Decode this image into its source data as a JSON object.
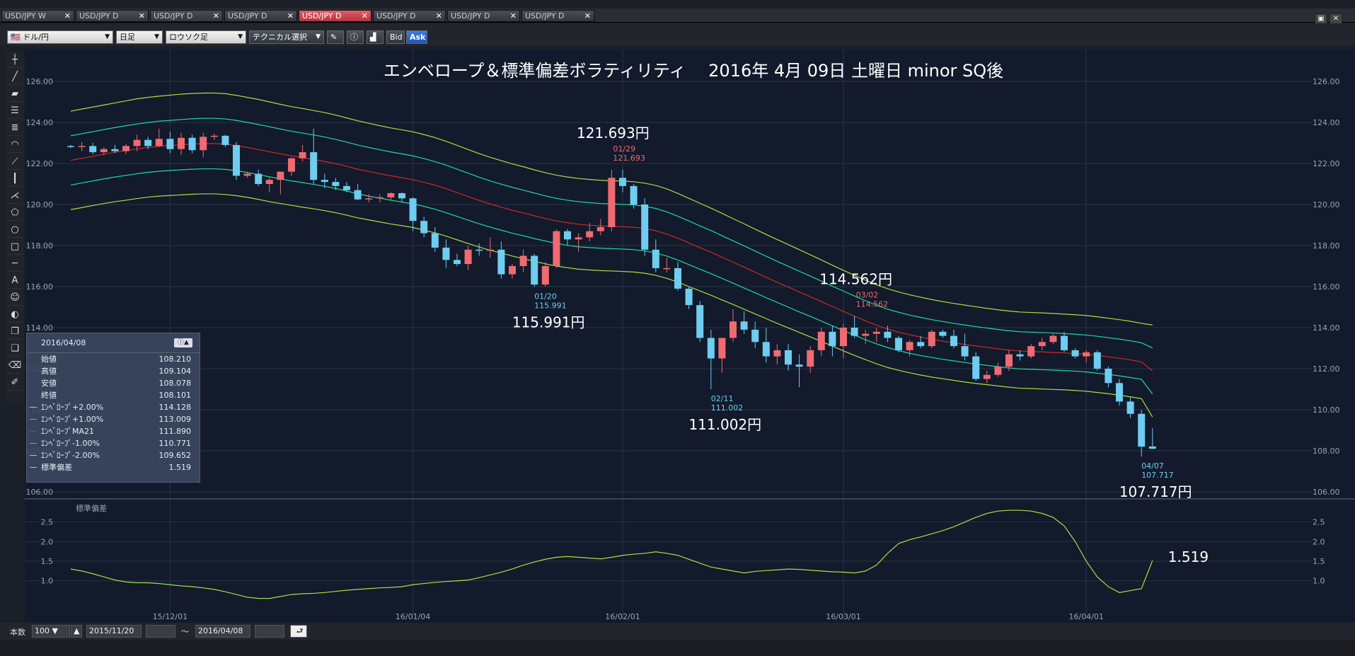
{
  "tabs": [
    {
      "label": "USD/JPY W",
      "active": false
    },
    {
      "label": "USD/JPY D",
      "active": false
    },
    {
      "label": "USD/JPY D",
      "active": false
    },
    {
      "label": "USD/JPY D",
      "active": false
    },
    {
      "label": "USD/JPY D",
      "active": true
    },
    {
      "label": "USD/JPY D",
      "active": false
    },
    {
      "label": "USD/JPY D",
      "active": false
    },
    {
      "label": "USD/JPY D",
      "active": false
    }
  ],
  "toolbar": {
    "pair": "ドル/円",
    "period": "日足",
    "chart_type": "ロウソク足",
    "technical": "テクニカル選択",
    "bid": "Bid",
    "ask": "Ask"
  },
  "chart": {
    "title": "エンベロープ＆標準偏差ボラティリティ　 2016年 4月 09日 土曜日  minor SQ後",
    "ylim": [
      106,
      126
    ],
    "yticks": [
      "126.00",
      "124.00",
      "122.00",
      "120.00",
      "118.00",
      "116.00",
      "114.00",
      "112.00",
      "110.00",
      "108.00",
      "106.00"
    ],
    "xticks": [
      {
        "label": "15/12/01",
        "i": 9
      },
      {
        "label": "16/01/04",
        "i": 31
      },
      {
        "label": "16/02/01",
        "i": 50
      },
      {
        "label": "16/03/01",
        "i": 70
      },
      {
        "label": "16/04/01",
        "i": 92
      }
    ],
    "candles": [
      [
        122.85,
        122.9,
        122.75,
        122.8
      ],
      [
        122.8,
        123.05,
        122.6,
        122.85
      ],
      [
        122.85,
        123.0,
        122.45,
        122.55
      ],
      [
        122.55,
        122.8,
        122.4,
        122.7
      ],
      [
        122.7,
        122.9,
        122.5,
        122.6
      ],
      [
        122.6,
        122.95,
        122.45,
        122.85
      ],
      [
        122.85,
        123.4,
        122.6,
        123.15
      ],
      [
        123.15,
        123.3,
        122.7,
        122.85
      ],
      [
        122.85,
        123.7,
        122.8,
        123.2
      ],
      [
        123.2,
        123.55,
        122.5,
        122.7
      ],
      [
        122.7,
        123.5,
        122.4,
        123.25
      ],
      [
        123.25,
        123.4,
        122.5,
        122.65
      ],
      [
        122.65,
        123.5,
        122.3,
        123.3
      ],
      [
        123.3,
        123.45,
        123.15,
        123.35
      ],
      [
        123.35,
        123.4,
        122.8,
        122.9
      ],
      [
        122.9,
        123.05,
        121.2,
        121.4
      ],
      [
        121.4,
        121.6,
        121.3,
        121.5
      ],
      [
        121.5,
        121.7,
        120.9,
        121.0
      ],
      [
        121.0,
        121.3,
        120.6,
        121.2
      ],
      [
        121.2,
        121.6,
        120.5,
        121.6
      ],
      [
        121.6,
        122.3,
        121.4,
        122.25
      ],
      [
        122.25,
        122.9,
        122.1,
        122.55
      ],
      [
        122.55,
        123.7,
        121.0,
        121.2
      ],
      [
        121.2,
        121.5,
        120.8,
        121.1
      ],
      [
        121.1,
        121.3,
        120.7,
        120.9
      ],
      [
        120.9,
        121.1,
        120.6,
        120.7
      ],
      [
        120.7,
        121.0,
        120.2,
        120.25
      ],
      [
        120.25,
        120.5,
        120.1,
        120.3
      ],
      [
        120.3,
        120.5,
        120.1,
        120.35
      ],
      [
        120.35,
        120.6,
        120.2,
        120.55
      ],
      [
        120.55,
        120.6,
        120.1,
        120.3
      ],
      [
        120.3,
        120.35,
        118.7,
        119.2
      ],
      [
        119.2,
        119.4,
        118.4,
        118.6
      ],
      [
        118.6,
        118.9,
        117.7,
        117.9
      ],
      [
        117.9,
        118.3,
        116.9,
        117.3
      ],
      [
        117.3,
        117.6,
        117.0,
        117.1
      ],
      [
        117.1,
        118.0,
        116.8,
        117.8
      ],
      [
        117.8,
        118.1,
        117.5,
        117.75
      ],
      [
        117.75,
        118.4,
        117.4,
        117.8
      ],
      [
        117.8,
        118.2,
        116.4,
        116.6
      ],
      [
        116.6,
        117.1,
        116.4,
        117.0
      ],
      [
        117.0,
        117.8,
        116.7,
        117.5
      ],
      [
        117.5,
        117.6,
        115.991,
        116.1
      ],
      [
        116.1,
        117.2,
        116.0,
        117.0
      ],
      [
        117.0,
        118.8,
        116.9,
        118.7
      ],
      [
        118.7,
        118.8,
        118.0,
        118.3
      ],
      [
        118.3,
        118.6,
        117.7,
        118.4
      ],
      [
        118.4,
        119.1,
        118.2,
        118.7
      ],
      [
        118.7,
        119.3,
        118.5,
        118.9
      ],
      [
        118.9,
        121.693,
        118.7,
        121.3
      ],
      [
        121.3,
        121.7,
        120.6,
        120.9
      ],
      [
        120.9,
        121.0,
        119.8,
        120.0
      ],
      [
        120.0,
        120.3,
        117.5,
        117.8
      ],
      [
        117.8,
        118.3,
        116.7,
        116.9
      ],
      [
        116.9,
        117.4,
        116.7,
        116.9
      ],
      [
        116.9,
        117.2,
        115.8,
        115.9
      ],
      [
        115.9,
        116.0,
        114.9,
        115.1
      ],
      [
        115.1,
        115.3,
        113.3,
        113.5
      ],
      [
        113.5,
        113.9,
        111.002,
        112.5
      ],
      [
        112.5,
        113.2,
        111.8,
        113.5
      ],
      [
        113.5,
        114.9,
        113.3,
        114.3
      ],
      [
        114.3,
        114.8,
        113.7,
        113.9
      ],
      [
        113.9,
        114.3,
        113.0,
        113.3
      ],
      [
        113.3,
        114.0,
        112.3,
        112.6
      ],
      [
        112.6,
        113.2,
        112.2,
        112.9
      ],
      [
        112.9,
        113.2,
        111.9,
        112.2
      ],
      [
        112.2,
        112.7,
        111.1,
        112.1
      ],
      [
        112.1,
        113.1,
        111.8,
        112.9
      ],
      [
        112.9,
        114.0,
        112.6,
        113.8
      ],
      [
        113.8,
        114.1,
        112.6,
        113.1
      ],
      [
        113.1,
        114.2,
        112.5,
        114.0
      ],
      [
        114.0,
        114.562,
        113.5,
        113.6
      ],
      [
        113.6,
        113.9,
        113.2,
        113.7
      ],
      [
        113.7,
        114.0,
        113.3,
        113.8
      ],
      [
        113.8,
        114.1,
        113.3,
        113.5
      ],
      [
        113.5,
        113.6,
        112.8,
        112.9
      ],
      [
        112.9,
        113.4,
        112.6,
        113.3
      ],
      [
        113.3,
        113.6,
        113.0,
        113.1
      ],
      [
        113.1,
        113.9,
        113.0,
        113.8
      ],
      [
        113.8,
        113.9,
        113.5,
        113.6
      ],
      [
        113.6,
        113.9,
        113.0,
        113.1
      ],
      [
        113.1,
        113.7,
        112.4,
        112.6
      ],
      [
        112.6,
        112.8,
        111.4,
        111.5
      ],
      [
        111.5,
        111.9,
        111.3,
        111.7
      ],
      [
        111.7,
        112.3,
        111.6,
        112.1
      ],
      [
        112.1,
        112.9,
        111.9,
        112.7
      ],
      [
        112.7,
        112.9,
        112.4,
        112.6
      ],
      [
        112.6,
        113.2,
        112.5,
        113.1
      ],
      [
        113.1,
        113.5,
        112.9,
        113.3
      ],
      [
        113.3,
        113.7,
        113.2,
        113.6
      ],
      [
        113.6,
        113.8,
        112.8,
        112.9
      ],
      [
        112.9,
        113.0,
        112.5,
        112.6
      ],
      [
        112.6,
        112.9,
        112.3,
        112.8
      ],
      [
        112.8,
        112.9,
        111.9,
        112.0
      ],
      [
        112.0,
        112.1,
        111.1,
        111.3
      ],
      [
        111.3,
        111.5,
        110.2,
        110.4
      ],
      [
        110.4,
        110.6,
        109.6,
        109.8
      ],
      [
        109.8,
        110.0,
        107.717,
        108.2
      ],
      [
        108.21,
        109.104,
        108.078,
        108.101
      ]
    ],
    "env_upper2": [
      124.55,
      124.65,
      124.75,
      124.85,
      124.95,
      125.05,
      125.15,
      125.22,
      125.28,
      125.33,
      125.38,
      125.41,
      125.43,
      125.43,
      125.4,
      125.32,
      125.22,
      125.12,
      125.0,
      124.88,
      124.77,
      124.68,
      124.58,
      124.48,
      124.36,
      124.22,
      124.08,
      123.96,
      123.84,
      123.73,
      123.64,
      123.54,
      123.41,
      123.26,
      123.08,
      122.88,
      122.68,
      122.48,
      122.3,
      122.14,
      121.98,
      121.84,
      121.69,
      121.55,
      121.43,
      121.34,
      121.27,
      121.22,
      121.18,
      121.16,
      121.14,
      121.11,
      121.04,
      120.93,
      120.76,
      120.54,
      120.3,
      120.06,
      119.82,
      119.57,
      119.31,
      119.06,
      118.8,
      118.54,
      118.29,
      118.05,
      117.8,
      117.55,
      117.3,
      117.04,
      116.79,
      116.55,
      116.31,
      116.09,
      115.9,
      115.74,
      115.6,
      115.48,
      115.37,
      115.27,
      115.18,
      115.1,
      115.02,
      114.94,
      114.87,
      114.81,
      114.76,
      114.74,
      114.72,
      114.69,
      114.66,
      114.63,
      114.59,
      114.53,
      114.46,
      114.39,
      114.31,
      114.21,
      114.13
    ],
    "env_upper1": [
      123.35,
      123.45,
      123.55,
      123.65,
      123.75,
      123.84,
      123.92,
      124.0,
      124.06,
      124.1,
      124.14,
      124.18,
      124.2,
      124.2,
      124.17,
      124.1,
      124.0,
      123.9,
      123.79,
      123.68,
      123.57,
      123.48,
      123.39,
      123.29,
      123.17,
      123.04,
      122.9,
      122.78,
      122.67,
      122.56,
      122.47,
      122.37,
      122.24,
      122.09,
      121.92,
      121.72,
      121.53,
      121.33,
      121.15,
      120.99,
      120.84,
      120.7,
      120.56,
      120.42,
      120.3,
      120.21,
      120.14,
      120.09,
      120.05,
      120.03,
      120.01,
      119.98,
      119.91,
      119.81,
      119.64,
      119.43,
      119.2,
      118.96,
      118.73,
      118.48,
      118.23,
      117.99,
      117.73,
      117.48,
      117.23,
      116.99,
      116.75,
      116.51,
      116.27,
      116.02,
      115.78,
      115.54,
      115.31,
      115.09,
      114.9,
      114.75,
      114.61,
      114.5,
      114.39,
      114.3,
      114.21,
      114.13,
      114.05,
      113.98,
      113.91,
      113.85,
      113.8,
      113.78,
      113.76,
      113.74,
      113.71,
      113.68,
      113.64,
      113.58,
      113.51,
      113.44,
      113.36,
      113.26,
      113.01
    ],
    "env_mid": [
      122.15,
      122.25,
      122.35,
      122.45,
      122.55,
      122.63,
      122.71,
      122.78,
      122.84,
      122.88,
      122.91,
      122.95,
      122.97,
      122.97,
      122.94,
      122.87,
      122.78,
      122.68,
      122.57,
      122.47,
      122.37,
      122.28,
      122.19,
      122.1,
      121.99,
      121.86,
      121.72,
      121.61,
      121.5,
      121.4,
      121.31,
      121.21,
      121.08,
      120.94,
      120.77,
      120.58,
      120.39,
      120.2,
      120.03,
      119.87,
      119.72,
      119.59,
      119.45,
      119.32,
      119.2,
      119.11,
      119.04,
      118.99,
      118.96,
      118.94,
      118.92,
      118.89,
      118.83,
      118.72,
      118.56,
      118.36,
      118.13,
      117.9,
      117.68,
      117.43,
      117.19,
      116.95,
      116.7,
      116.45,
      116.21,
      115.98,
      115.74,
      115.51,
      115.27,
      115.03,
      114.79,
      114.56,
      114.33,
      114.12,
      113.93,
      113.78,
      113.65,
      113.54,
      113.44,
      113.34,
      113.26,
      113.18,
      113.11,
      113.04,
      112.97,
      112.91,
      112.86,
      112.84,
      112.82,
      112.79,
      112.77,
      112.74,
      112.7,
      112.64,
      112.58,
      112.51,
      112.43,
      112.33,
      111.89
    ],
    "env_lower1": [
      120.95,
      121.05,
      121.15,
      121.25,
      121.34,
      121.42,
      121.5,
      121.57,
      121.62,
      121.66,
      121.69,
      121.72,
      121.74,
      121.74,
      121.71,
      121.65,
      121.56,
      121.46,
      121.35,
      121.25,
      121.15,
      121.07,
      120.98,
      120.89,
      120.78,
      120.66,
      120.52,
      120.41,
      120.31,
      120.21,
      120.12,
      120.03,
      119.91,
      119.77,
      119.6,
      119.42,
      119.24,
      119.06,
      118.9,
      118.75,
      118.6,
      118.48,
      118.34,
      118.22,
      118.11,
      118.01,
      117.94,
      117.9,
      117.87,
      117.85,
      117.83,
      117.8,
      117.74,
      117.64,
      117.49,
      117.29,
      117.07,
      116.85,
      116.63,
      116.4,
      116.17,
      115.93,
      115.7,
      115.46,
      115.23,
      115.0,
      114.77,
      114.55,
      114.32,
      114.09,
      113.86,
      113.63,
      113.41,
      113.21,
      113.03,
      112.88,
      112.75,
      112.64,
      112.55,
      112.46,
      112.38,
      112.3,
      112.23,
      112.16,
      112.1,
      112.04,
      111.99,
      111.97,
      111.95,
      111.93,
      111.91,
      111.88,
      111.84,
      111.78,
      111.72,
      111.65,
      111.57,
      111.48,
      110.77
    ],
    "env_lower2": [
      119.75,
      119.85,
      119.95,
      120.05,
      120.14,
      120.21,
      120.29,
      120.36,
      120.41,
      120.44,
      120.47,
      120.5,
      120.52,
      120.52,
      120.49,
      120.43,
      120.35,
      120.25,
      120.14,
      120.05,
      119.96,
      119.87,
      119.79,
      119.7,
      119.6,
      119.48,
      119.35,
      119.25,
      119.15,
      119.05,
      118.97,
      118.88,
      118.75,
      118.62,
      118.46,
      118.28,
      118.1,
      117.93,
      117.77,
      117.63,
      117.49,
      117.36,
      117.23,
      117.11,
      117.0,
      116.92,
      116.85,
      116.81,
      116.78,
      116.76,
      116.74,
      116.71,
      116.65,
      116.55,
      116.4,
      116.22,
      116.0,
      115.79,
      115.58,
      115.35,
      115.13,
      114.9,
      114.67,
      114.44,
      114.21,
      113.99,
      113.77,
      113.55,
      113.33,
      113.1,
      112.87,
      112.65,
      112.44,
      112.24,
      112.06,
      111.92,
      111.8,
      111.69,
      111.59,
      111.51,
      111.43,
      111.35,
      111.28,
      111.22,
      111.16,
      111.1,
      111.05,
      111.03,
      111.01,
      110.99,
      110.97,
      110.94,
      110.9,
      110.84,
      110.78,
      110.71,
      110.63,
      110.54,
      109.65
    ],
    "stddev": [
      1.3,
      1.25,
      1.18,
      1.1,
      1.02,
      0.97,
      0.95,
      0.95,
      0.93,
      0.9,
      0.87,
      0.85,
      0.82,
      0.78,
      0.72,
      0.65,
      0.58,
      0.55,
      0.55,
      0.6,
      0.65,
      0.67,
      0.68,
      0.7,
      0.73,
      0.76,
      0.78,
      0.8,
      0.82,
      0.83,
      0.85,
      0.9,
      0.93,
      0.96,
      0.98,
      1.0,
      1.02,
      1.08,
      1.15,
      1.22,
      1.3,
      1.4,
      1.48,
      1.55,
      1.6,
      1.62,
      1.6,
      1.58,
      1.56,
      1.6,
      1.65,
      1.68,
      1.7,
      1.74,
      1.7,
      1.65,
      1.55,
      1.45,
      1.35,
      1.3,
      1.25,
      1.2,
      1.24,
      1.26,
      1.28,
      1.3,
      1.29,
      1.27,
      1.25,
      1.23,
      1.22,
      1.2,
      1.25,
      1.4,
      1.7,
      1.95,
      2.05,
      2.12,
      2.2,
      2.28,
      2.38,
      2.5,
      2.62,
      2.72,
      2.78,
      2.8,
      2.8,
      2.78,
      2.72,
      2.62,
      2.4,
      2.0,
      1.5,
      1.1,
      0.85,
      0.7,
      0.75,
      0.8,
      1.519
    ],
    "sd_ylim": [
      0.2,
      3.0
    ],
    "sd_yticks": [
      "2.5",
      "2.0",
      "1.5",
      "1.0"
    ],
    "sd_label": "標準偏差",
    "annotations": [
      {
        "i": 42,
        "date": "01/20",
        "price": "115.991",
        "big": "115.991円",
        "type": "low"
      },
      {
        "i": 49,
        "date": "01/29",
        "price": "121.693",
        "big": "121.693円",
        "type": "high"
      },
      {
        "i": 58,
        "date": "02/11",
        "price": "111.002",
        "big": "111.002円",
        "type": "low"
      },
      {
        "i": 71,
        "date": "03/02",
        "price": "114.562",
        "big": "114.562円",
        "type": "high"
      },
      {
        "i": 97,
        "date": "04/07",
        "price": "107.717",
        "big": "107.717円",
        "type": "low"
      }
    ],
    "sd_current": "1.519"
  },
  "info": {
    "date": "2016/04/08",
    "rows": [
      {
        "label": "始値",
        "value": "108.210",
        "color": ""
      },
      {
        "label": "高値",
        "value": "109.104",
        "color": ""
      },
      {
        "label": "安値",
        "value": "108.078",
        "color": ""
      },
      {
        "label": "終値",
        "value": "108.101",
        "color": ""
      },
      {
        "label": "ｴﾝﾍﾞﾛｰﾌﾟ+2.00%",
        "value": "114.128",
        "color": "#a8e040"
      },
      {
        "label": "ｴﾝﾍﾞﾛｰﾌﾟ+1.00%",
        "value": "113.009",
        "color": "#20d8a0"
      },
      {
        "label": "ｴﾝﾍﾞﾛｰﾌﾟMA21",
        "value": "111.890",
        "color": "#d02828"
      },
      {
        "label": "ｴﾝﾍﾞﾛｰﾌﾟ-1.00%",
        "value": "110.771",
        "color": "#20d8a0"
      },
      {
        "label": "ｴﾝﾍﾞﾛｰﾌﾟ-2.00%",
        "value": "109.652",
        "color": "#a8e040"
      },
      {
        "label": "標準偏差",
        "value": "1.519",
        "color": "#a8e040"
      }
    ]
  },
  "bottom": {
    "count_label": "本数",
    "count": "100",
    "from": "2015/11/20",
    "to": "2016/04/08",
    "sep": "〜"
  }
}
